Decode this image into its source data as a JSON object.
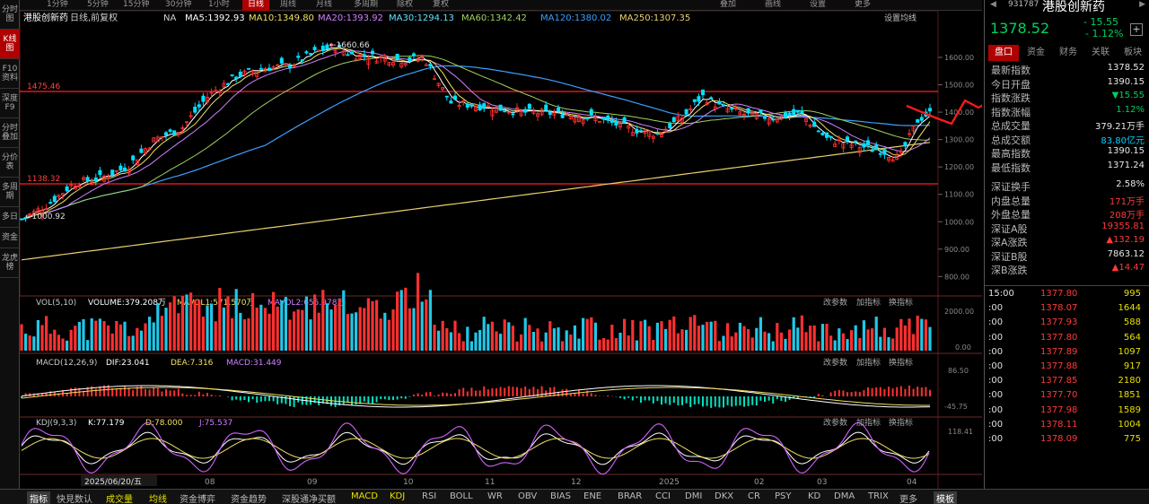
{
  "left_tabs": [
    "分时图",
    "K线图",
    "F10资料",
    "深度F9",
    "分时叠加",
    "分价表",
    "多周期",
    "多日",
    "资金",
    "龙虎榜"
  ],
  "top_tabs": [
    "1分钟",
    "5分钟",
    "15分钟",
    "30分钟",
    "1小时",
    "日线",
    "周线",
    "月线",
    "多周期",
    "除权",
    "复权",
    "叠加",
    "画线",
    "设置",
    "更多"
  ],
  "chart": {
    "name": "港股创新药",
    "period": "日线,前复权",
    "ma_na": "NA",
    "ma5": "MA5:1392.93",
    "ma10": "MA10:1349.80",
    "ma20": "MA20:1393.92",
    "ma30": "MA30:1294.13",
    "ma60": "MA60:1342.42",
    "ma120": "MA120:1380.02",
    "ma250": "MA250:1307.35",
    "settings": "设置均线",
    "ann_high": "1660.66",
    "ann_low": "1000.92",
    "line_label_top": "1475.46",
    "line_label_bottom": "1138.32",
    "yticks": [
      "1600.00",
      "1500.00",
      "1400.00",
      "1300.00",
      "1200.00",
      "1100.00",
      "1000.00",
      "900.00",
      "800.00"
    ],
    "vol_title": "VOL(5,10)",
    "vol_val": "VOLUME:379.208万",
    "vol_ma1": "MAVOL1:571.570万",
    "vol_ma2": "MAVOL2:655.978万",
    "vol_yticks": [
      "2000.00",
      "0.00"
    ],
    "macd_title": "MACD(12,26,9)",
    "macd_dif": "DIF:23.041",
    "macd_dea": "DEA:7.316",
    "macd_val": "MACD:31.449",
    "macd_yticks": [
      "86.50",
      "-45.75"
    ],
    "kdj_title": "KDJ(9,3,3)",
    "kdj_k": "K:77.179",
    "kdj_d": "D:78.000",
    "kdj_j": "J:75.537",
    "kdj_ytick": "118.41",
    "panel_tools": [
      "改参数",
      "加指标",
      "换指标"
    ],
    "date_label": "2025/06/20/五",
    "xlabels": [
      "08",
      "09",
      "10",
      "11",
      "12",
      "2025",
      "02",
      "03",
      "04"
    ]
  },
  "bottom_tabs": [
    "指标",
    "快見数认",
    "成交量",
    "均线",
    "资金博弈",
    "资金趋势",
    "深股通净买额",
    "MACD",
    "KDJ",
    "RSI",
    "BOLL",
    "WR",
    "OBV",
    "BIAS",
    "ENE",
    "BRAR",
    "CCI",
    "DMI",
    "DKX",
    "CR",
    "PSY",
    "KD",
    "DMA",
    "TRIX",
    "更多",
    "模板"
  ],
  "right": {
    "code": "931787",
    "name": "港股创新药",
    "price": "1378.52",
    "change": "- 15.55",
    "change_pct": "- 1.12%",
    "tabs": [
      "盘口",
      "资金",
      "财务",
      "关联",
      "板块"
    ],
    "quotes": [
      {
        "label": "最新指数",
        "value": "1378.52",
        "color": "wht"
      },
      {
        "label": "今日开盘",
        "value": "1390.15",
        "color": "wht"
      },
      {
        "label": "指数涨跌",
        "value": "▼15.55",
        "color": "grn"
      },
      {
        "label": "指数涨幅",
        "value": "1.12%",
        "color": "grn"
      },
      {
        "label": "总成交量",
        "value": "379.21万手",
        "color": "wht"
      },
      {
        "label": "总成交额",
        "value": "83.80亿元",
        "color": "cy"
      },
      {
        "label": "最高指数",
        "value": "1390.15",
        "color": "wht"
      },
      {
        "label": "最低指数",
        "value": "1371.24",
        "color": "wht"
      },
      {
        "label": "深证换手",
        "value": "2.58%",
        "color": "wht"
      },
      {
        "label": "内盘总量",
        "value": "171万手",
        "color": "red"
      },
      {
        "label": "外盘总量",
        "value": "208万手",
        "color": "red"
      },
      {
        "label": "深证A股",
        "value": "19355.81",
        "color": "red"
      },
      {
        "label": "深A涨跌",
        "value": "▲132.19",
        "color": "red"
      },
      {
        "label": "深证B股",
        "value": "7863.12",
        "color": "wht"
      },
      {
        "label": "深B涨跌",
        "value": "▲14.47",
        "color": "red"
      }
    ],
    "ticks": [
      {
        "time": "15:00",
        "price": "1377.80",
        "vol": "995"
      },
      {
        "time": ":00",
        "price": "1378.07",
        "vol": "1644"
      },
      {
        "time": ":00",
        "price": "1377.93",
        "vol": "588"
      },
      {
        "time": ":00",
        "price": "1377.80",
        "vol": "564"
      },
      {
        "time": ":00",
        "price": "1377.89",
        "vol": "1097"
      },
      {
        "time": ":00",
        "price": "1377.88",
        "vol": "917"
      },
      {
        "time": ":00",
        "price": "1377.85",
        "vol": "2180"
      },
      {
        "time": ":00",
        "price": "1377.70",
        "vol": "1851"
      },
      {
        "time": ":00",
        "price": "1377.98",
        "vol": "1589"
      },
      {
        "time": ":00",
        "price": "1378.11",
        "vol": "1004"
      },
      {
        "time": ":00",
        "price": "1378.09",
        "vol": "775"
      }
    ]
  }
}
